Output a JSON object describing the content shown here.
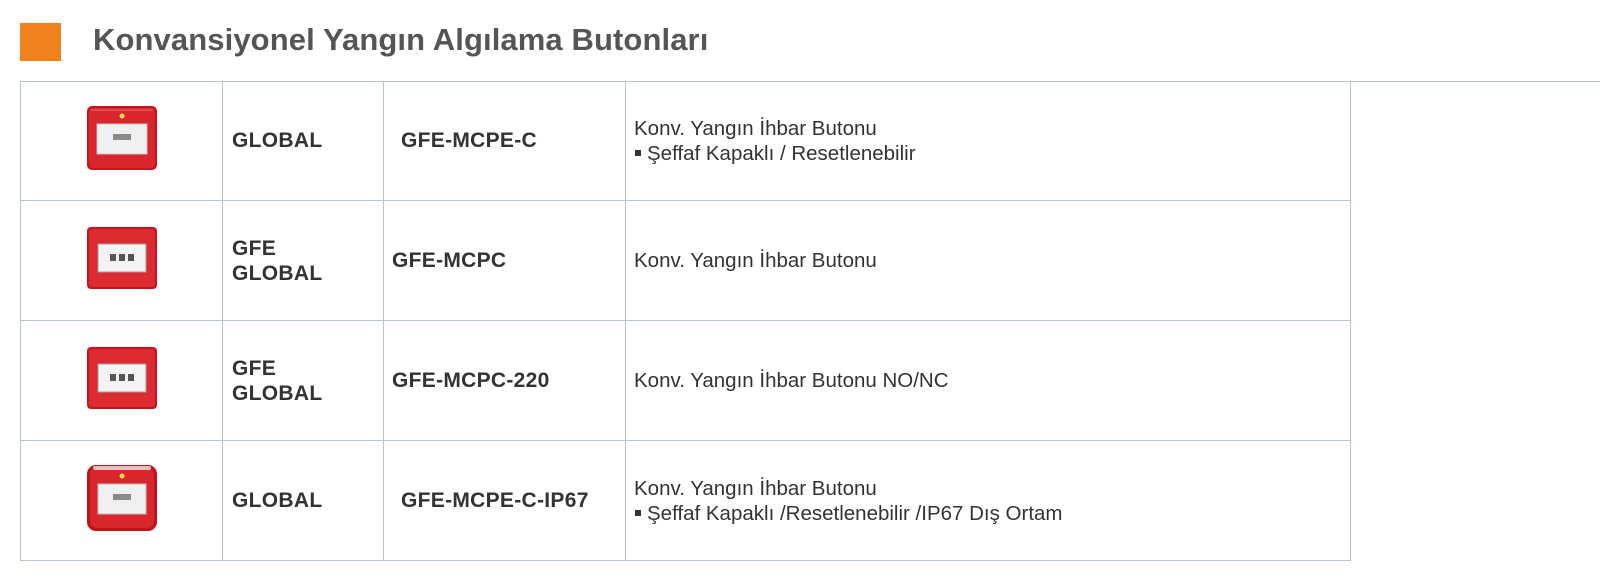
{
  "heading": {
    "title": "Konvansiyonel Yangın Algılama Butonları",
    "accent_color": "#f0821e"
  },
  "rows": [
    {
      "icon": "fire-alarm-button-clear-cover-icon",
      "brand_lines": [
        "GLOBAL"
      ],
      "code": "GFE-MCPE-C",
      "desc_lines": [
        "Konv. Yangın İhbar Butonu",
        "Şeffaf Kapaklı / Resetlenebilir"
      ],
      "bullet_from_line": 1
    },
    {
      "icon": "fire-alarm-button-icon",
      "brand_lines": [
        "GFE",
        "GLOBAL"
      ],
      "code": "GFE-MCPC",
      "desc_lines": [
        "Konv. Yangın İhbar Butonu"
      ],
      "bullet_from_line": 99
    },
    {
      "icon": "fire-alarm-button-icon",
      "brand_lines": [
        "GFE",
        "GLOBAL"
      ],
      "code": "GFE-MCPC-220",
      "desc_lines": [
        "Konv. Yangın İhbar Butonu NO/NC"
      ],
      "bullet_from_line": 99
    },
    {
      "icon": "fire-alarm-button-ip67-icon",
      "brand_lines": [
        "GLOBAL"
      ],
      "code": "GFE-MCPE-C-IP67",
      "desc_lines": [
        "Konv. Yangın İhbar Butonu",
        "Şeffaf Kapaklı /Resetlenebilir /IP67 Dış Ortam"
      ],
      "bullet_from_line": 1
    }
  ]
}
